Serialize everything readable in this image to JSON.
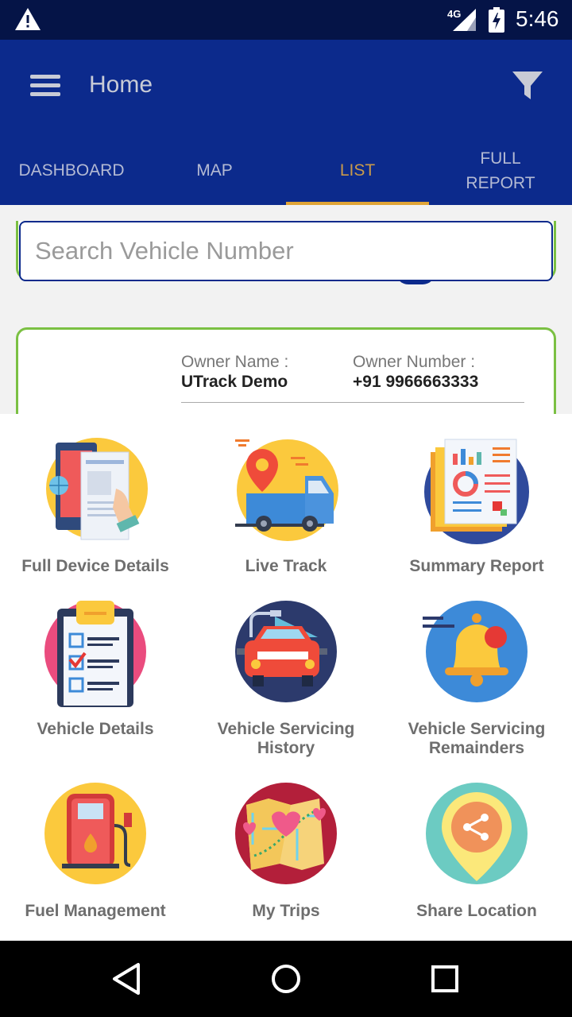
{
  "status_bar": {
    "network": "4G",
    "time": "5:46"
  },
  "toolbar": {
    "title": "Home"
  },
  "tabs": [
    {
      "label": "DASHBOARD"
    },
    {
      "label": "MAP"
    },
    {
      "label": "LIST",
      "active": true
    },
    {
      "label": "FULL\nREPORT"
    }
  ],
  "search": {
    "placeholder": "Search Vehicle Number"
  },
  "card": {
    "owner_name_label": "Owner Name :",
    "owner_name_value": "UTrack Demo",
    "owner_number_label": "Owner Number :",
    "owner_number_value": "+91 9966663333"
  },
  "menu": [
    {
      "label": "Full Device Details",
      "icon": "device-details-icon"
    },
    {
      "label": "Live Track",
      "icon": "live-track-icon"
    },
    {
      "label": "Summary Report",
      "icon": "summary-report-icon"
    },
    {
      "label": "Vehicle Details",
      "icon": "vehicle-details-icon"
    },
    {
      "label": "Vehicle Servicing History",
      "icon": "servicing-history-icon"
    },
    {
      "label": "Vehicle Servicing Remainders",
      "icon": "reminder-bell-icon"
    },
    {
      "label": "Fuel Management",
      "icon": "fuel-pump-icon"
    },
    {
      "label": "My Trips",
      "icon": "trip-map-icon"
    },
    {
      "label": "Share Location",
      "icon": "share-location-icon"
    }
  ],
  "colors": {
    "primary": "#0c2a8c",
    "status_bar": "#051447",
    "accent": "#e0a437",
    "card_border": "#7bc043"
  }
}
